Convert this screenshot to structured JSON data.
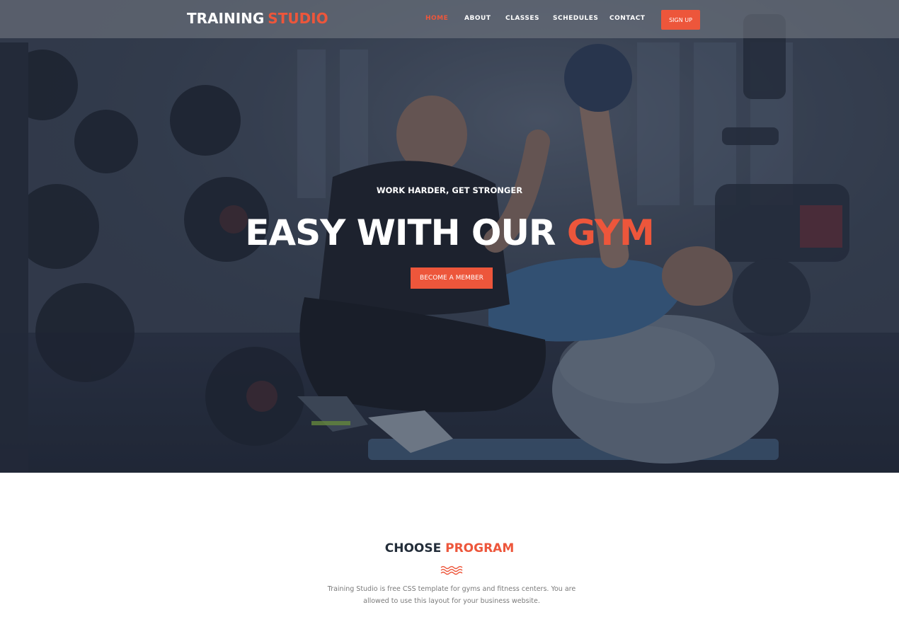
{
  "brand": {
    "primary": "TRAINING",
    "accent": "STUDIO",
    "accent_color": "#ed563b"
  },
  "nav": {
    "items": [
      {
        "label": "HOME",
        "active": true
      },
      {
        "label": "ABOUT",
        "active": false
      },
      {
        "label": "CLASSES",
        "active": false
      },
      {
        "label": "SCHEDULES",
        "active": false
      },
      {
        "label": "CONTACT",
        "active": false
      }
    ],
    "signup_label": "SIGN UP"
  },
  "hero": {
    "subtitle": "WORK HARDER, GET STRONGER",
    "title_main": "EASY WITH OUR",
    "title_accent": "GYM",
    "cta_label": "BECOME A MEMBER",
    "background_image": "gym workout photo"
  },
  "program": {
    "title_main": "CHOOSE",
    "title_accent": "PROGRAM",
    "divider_icon": "waves-icon",
    "description": "Training Studio is free CSS template for gyms and fitness centers. You are allowed to use this layout for your business website."
  }
}
